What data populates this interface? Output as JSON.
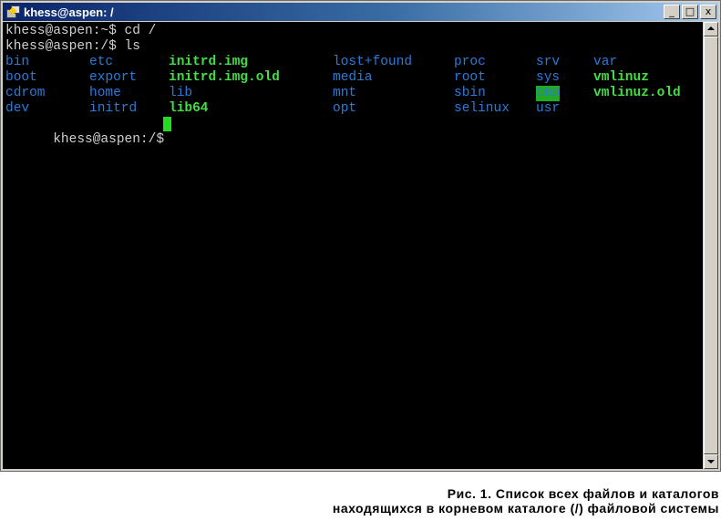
{
  "window": {
    "title": "khess@aspen: /",
    "btn_min": "_",
    "btn_max": "□",
    "btn_close": "x"
  },
  "colors": {
    "dir": "#2a7bd8",
    "exe": "#44dd44",
    "plain": "#c8c8c8",
    "sticky_bg": "#22aa22"
  },
  "terminal": {
    "line1": "khess@aspen:~$ cd /",
    "line2": "khess@aspen:/$ ls",
    "prompt": "khess@aspen:/$ ",
    "listing": [
      [
        "bin",
        "etc",
        "initrd.img",
        "lost+found",
        "proc",
        "srv",
        "var"
      ],
      [
        "boot",
        "export",
        "initrd.img.old",
        "media",
        "root",
        "sys",
        "vmlinuz"
      ],
      [
        "cdrom",
        "home",
        "lib",
        "mnt",
        "sbin",
        "tmp",
        "vmlinuz.old"
      ],
      [
        "dev",
        "initrd",
        "lib64",
        "opt",
        "selinux",
        "usr",
        ""
      ]
    ]
  },
  "caption": {
    "line1": "Рис. 1. Список всех файлов и каталогов",
    "line2": "находящихся в  корневом каталоге (/) файловой системы"
  }
}
